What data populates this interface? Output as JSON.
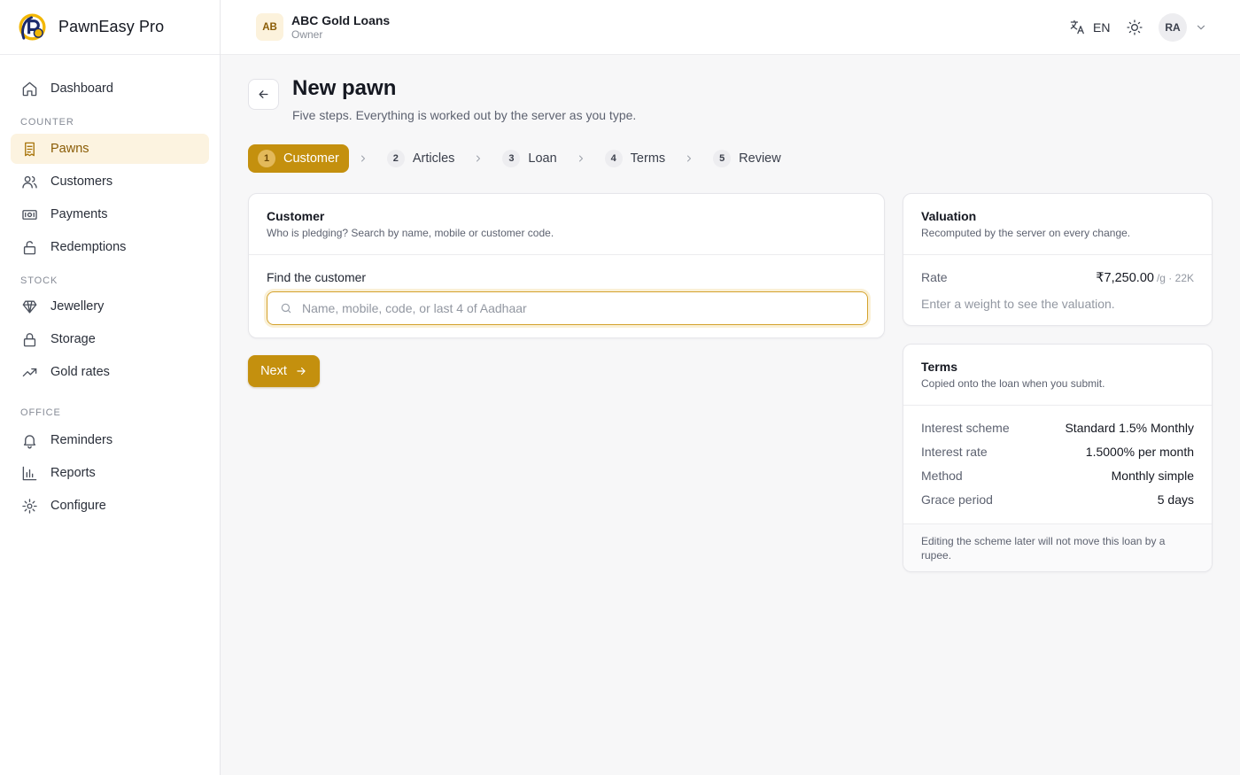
{
  "app": {
    "name": "PawnEasy Pro"
  },
  "sidebar": {
    "top_items": [
      {
        "label": "Dashboard",
        "icon": "home-icon"
      }
    ],
    "sections": [
      {
        "title": "COUNTER",
        "items": [
          {
            "label": "Pawns",
            "icon": "receipt-icon",
            "active": true
          },
          {
            "label": "Customers",
            "icon": "users-icon"
          },
          {
            "label": "Payments",
            "icon": "banknote-icon"
          },
          {
            "label": "Redemptions",
            "icon": "unlock-icon"
          }
        ]
      },
      {
        "title": "STOCK",
        "items": [
          {
            "label": "Jewellery",
            "icon": "gem-icon"
          },
          {
            "label": "Storage",
            "icon": "lock-icon"
          },
          {
            "label": "Gold rates",
            "icon": "trend-up-icon"
          }
        ]
      },
      {
        "title": "OFFICE",
        "items": [
          {
            "label": "Reminders",
            "icon": "bell-icon"
          },
          {
            "label": "Reports",
            "icon": "bar-chart-icon"
          },
          {
            "label": "Configure",
            "icon": "gear-icon"
          }
        ]
      }
    ]
  },
  "topbar": {
    "org_initials": "AB",
    "org_name": "ABC Gold Loans",
    "org_role": "Owner",
    "language": "EN",
    "user_initials": "RA"
  },
  "page": {
    "title": "New pawn",
    "subtitle": "Five steps. Everything is worked out by the server as you type."
  },
  "steps": [
    {
      "num": "1",
      "label": "Customer",
      "active": true
    },
    {
      "num": "2",
      "label": "Articles"
    },
    {
      "num": "3",
      "label": "Loan"
    },
    {
      "num": "4",
      "label": "Terms"
    },
    {
      "num": "5",
      "label": "Review"
    }
  ],
  "customer_card": {
    "title": "Customer",
    "description": "Who is pledging? Search by name, mobile or customer code.",
    "field_label": "Find the customer",
    "search_value": "",
    "search_placeholder": "Name, mobile, code, or last 4 of Aadhaar"
  },
  "next_button": {
    "label": "Next"
  },
  "valuation": {
    "title": "Valuation",
    "description": "Recomputed by the server on every change.",
    "rate_label": "Rate",
    "rate_value": "₹7,250.00",
    "rate_unit": "/g · 22K",
    "hint": "Enter a weight to see the valuation."
  },
  "terms": {
    "title": "Terms",
    "description": "Copied onto the loan when you submit.",
    "rows": [
      {
        "label": "Interest scheme",
        "value": "Standard 1.5% Monthly"
      },
      {
        "label": "Interest rate",
        "value": "1.5000% per month"
      },
      {
        "label": "Method",
        "value": "Monthly simple"
      },
      {
        "label": "Grace period",
        "value": "5 days"
      }
    ],
    "footnote": "Editing the scheme later will not move this loan by a rupee."
  },
  "colors": {
    "accent": "#c4900e",
    "accent_soft": "#fcf3e0",
    "active_text": "#8a5c06"
  }
}
